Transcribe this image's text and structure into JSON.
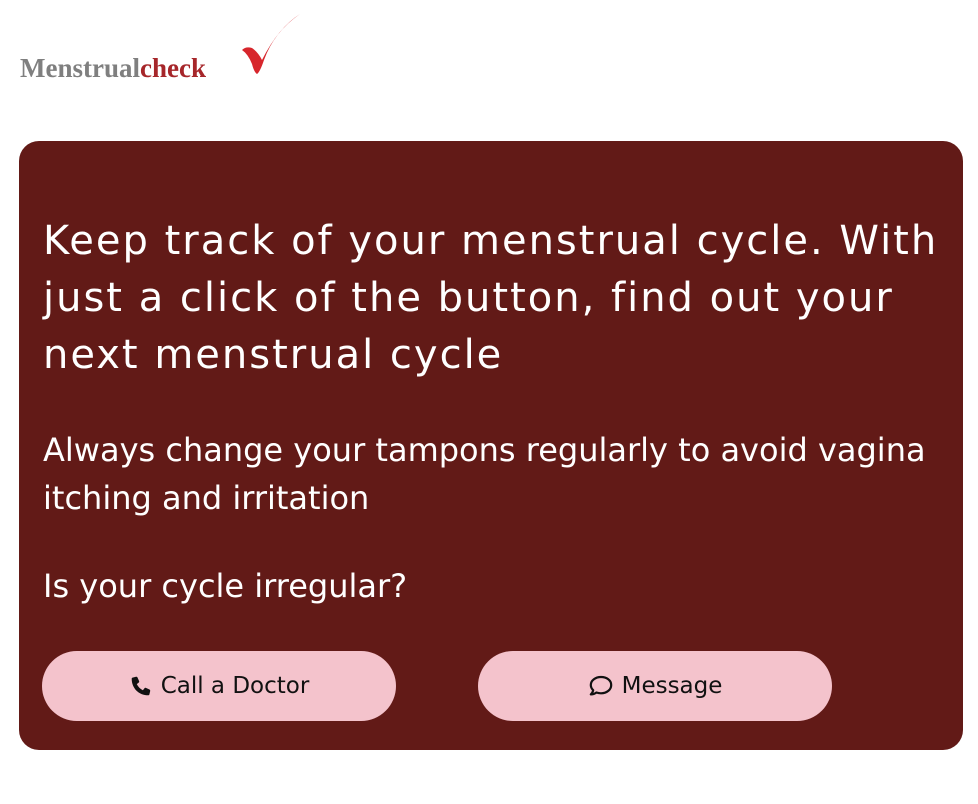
{
  "header": {
    "logo_part1": "Menstrual",
    "logo_part2": "check",
    "logo_check_icon": "checkmark-icon"
  },
  "hero": {
    "headline": "Keep track of your menstrual cycle. With just a click of the button, find out your next menstrual cycle",
    "tip": "Always change your tampons regularly to avoid vagina itching and irritation",
    "question": "Is your cycle irregular?"
  },
  "actions": {
    "call_label": "Call a Doctor",
    "call_icon": "phone-icon",
    "message_label": "Message",
    "message_icon": "chat-bubble-icon"
  },
  "colors": {
    "card_background": "#621a17",
    "button_background": "#f4c3cc",
    "logo_gray": "#7f7f7f",
    "logo_red": "#a6262a",
    "check_red": "#d7262c"
  }
}
